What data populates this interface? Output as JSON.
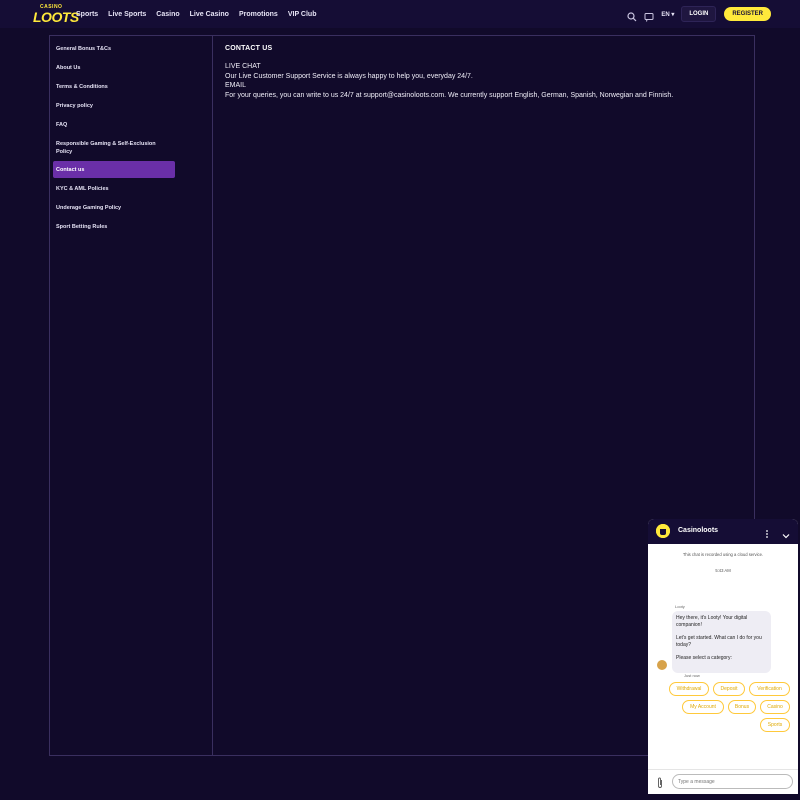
{
  "header": {
    "logo_top": "CASINO",
    "logo_main": "LOOTS",
    "nav": [
      "Sports",
      "Live Sports",
      "Casino",
      "Live Casino",
      "Promotions",
      "VIP Club"
    ],
    "lang": "EN ▾",
    "login": "LOGIN",
    "register": "REGISTER",
    "icons": [
      "search-icon",
      "chat-icon"
    ]
  },
  "sidebar": {
    "items": [
      {
        "label": "General Bonus T&Cs"
      },
      {
        "label": "About Us"
      },
      {
        "label": "Terms & Conditions"
      },
      {
        "label": "Privacy policy"
      },
      {
        "label": "FAQ"
      },
      {
        "label": "Responsible Gaming & Self-Exclusion Policy"
      },
      {
        "label": "Contact us",
        "active": true
      },
      {
        "label": "KYC & AML Policies"
      },
      {
        "label": "Underage Gaming Policy"
      },
      {
        "label": "Sport Betting Rules"
      }
    ]
  },
  "content": {
    "title": "CONTACT US",
    "lines": [
      "LIVE CHAT",
      "Our Live Customer Support Service is always happy to help you, everyday 24/7.",
      "EMAIL",
      "For your queries, you can write to us 24/7 at support@casinoloots.com. We currently support English, German, Spanish, Norwegian and Finnish."
    ]
  },
  "chat": {
    "title": "Casinoloots",
    "recorded_notice": "This chat is recorded using a cloud service.",
    "time": "5:43 AM",
    "bot_name": "Looty",
    "messages": [
      "Hey there, it's Looty! Your digital companion!",
      "Let's get started. What can I do for you today?",
      "Please select a category:"
    ],
    "just_now": "Just now",
    "options": [
      "Withdrawal",
      "Deposit",
      "Verification",
      "My Account",
      "Bonus",
      "Casino",
      "Sports"
    ],
    "input_placeholder": "Type a message",
    "colors": {
      "chip_border": "#ffc93b",
      "header_bg": "#150d35",
      "accent": "#ffe93b",
      "active_nav": "#6a2fa8"
    }
  }
}
